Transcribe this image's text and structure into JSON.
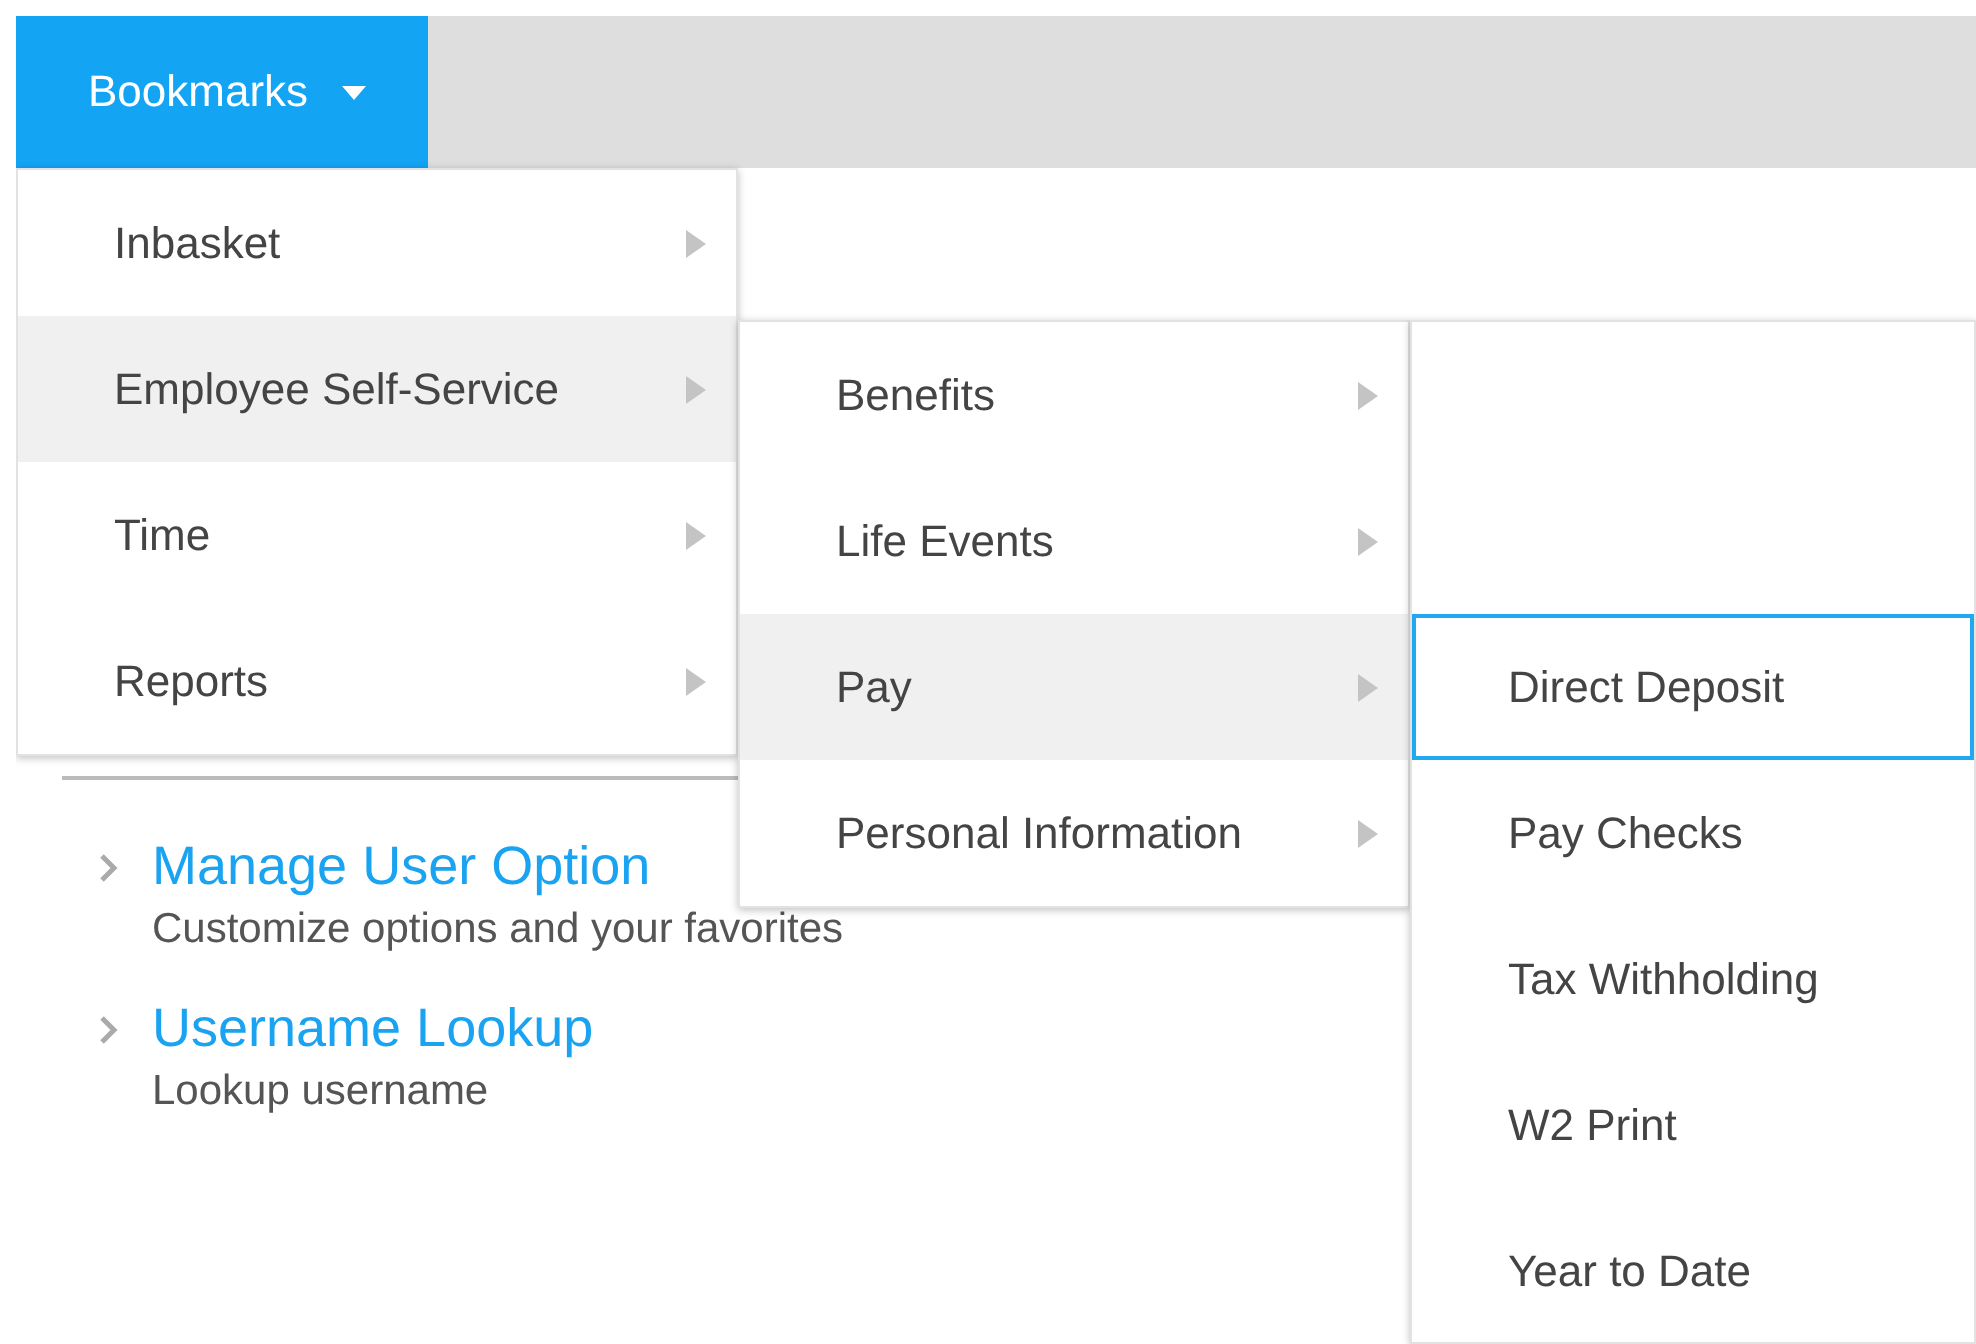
{
  "toolbar": {
    "bookmarks_button": {
      "label": "Bookmarks",
      "expanded": true
    }
  },
  "menus": [
    {
      "kind": "cascade",
      "items": [
        {
          "label": "Inbasket",
          "selected": false,
          "has_submenu": true
        },
        {
          "label": "Employee Self-Service",
          "selected": true,
          "has_submenu": true
        },
        {
          "label": "Time",
          "selected": false,
          "has_submenu": true
        },
        {
          "label": "Reports",
          "selected": false,
          "has_submenu": true
        }
      ]
    },
    {
      "kind": "cascade",
      "items": [
        {
          "label": "Benefits",
          "selected": false,
          "has_submenu": true
        },
        {
          "label": "Life Events",
          "selected": false,
          "has_submenu": true
        },
        {
          "label": "Pay",
          "selected": true,
          "has_submenu": true
        },
        {
          "label": "Personal Information",
          "selected": false,
          "has_submenu": true
        }
      ]
    },
    {
      "kind": "leaf",
      "items": [
        {
          "label": "Direct Deposit",
          "selected": true
        },
        {
          "label": "Pay Checks",
          "selected": false
        },
        {
          "label": "Tax Withholding",
          "selected": false
        },
        {
          "label": "W2 Print",
          "selected": false
        },
        {
          "label": "Year to Date",
          "selected": false
        }
      ]
    }
  ],
  "links": [
    {
      "title": "Manage User Option",
      "description": "Customize options and your favorites"
    },
    {
      "title": "Username Lookup",
      "description": "Lookup username"
    }
  ]
}
